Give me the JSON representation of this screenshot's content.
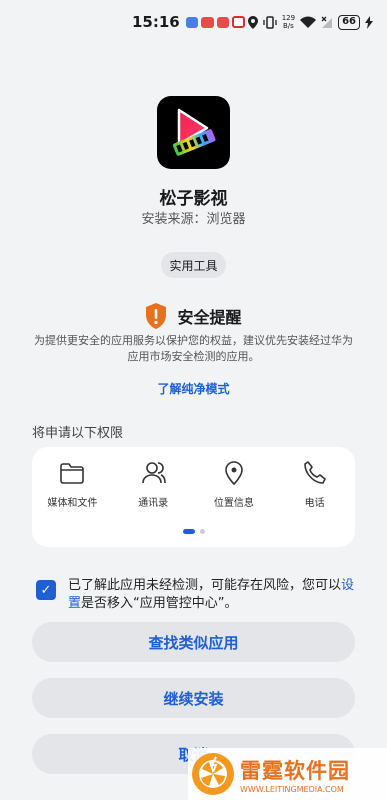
{
  "status_bar": {
    "time": "15:16",
    "net_speed_value": "129",
    "net_speed_unit": "B/s",
    "battery": "66"
  },
  "app": {
    "name": "松子影视",
    "source": "安装来源：浏览器",
    "category": "实用工具"
  },
  "security": {
    "title": "安全提醒",
    "description": "为提供更安全的应用服务以保护您的权益，建议优先安装经过华为应用市场安全检测的应用。",
    "link": "了解纯净模式"
  },
  "permissions": {
    "title": "将申请以下权限",
    "items": [
      {
        "label": "媒体和文件",
        "icon": "folder-icon"
      },
      {
        "label": "通讯录",
        "icon": "contacts-icon"
      },
      {
        "label": "位置信息",
        "icon": "location-icon"
      },
      {
        "label": "电话",
        "icon": "phone-icon"
      }
    ]
  },
  "consent": {
    "text_before": "已了解此应用未经检测，可能存在风险，您可以",
    "link": "设置",
    "text_after": "是否移入“应用管控中心”。"
  },
  "buttons": {
    "find_similar": "查找类似应用",
    "continue": "继续安装",
    "cancel": "取消"
  },
  "watermark": {
    "name": "雷霆软件园",
    "url": "WWW.LEITINGMEDIA.COM"
  },
  "colors": {
    "accent": "#1f5fd6",
    "warning": "#e8711d",
    "background": "#f1f3f5"
  }
}
